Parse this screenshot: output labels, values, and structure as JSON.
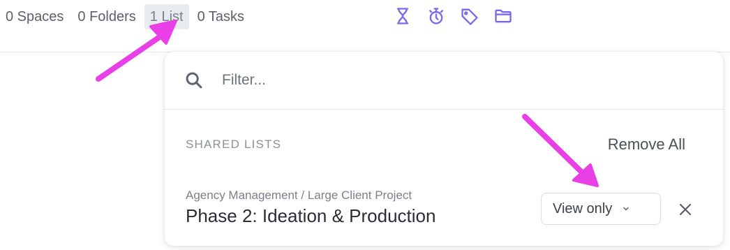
{
  "counts": [
    {
      "value": "0",
      "label": "Spaces"
    },
    {
      "value": "0",
      "label": "Folders"
    },
    {
      "value": "1",
      "label": "List"
    },
    {
      "value": "0",
      "label": "Tasks"
    }
  ],
  "count_texts": [
    "0 Spaces",
    "0 Folders",
    "1 List",
    "0 Tasks"
  ],
  "toolbar_icons": [
    "hourglass-icon",
    "stopwatch-icon",
    "tag-icon",
    "folder-icon"
  ],
  "accent_color": "#7b68ee",
  "annotation_color": "#e83fe6",
  "share_panel": {
    "filter_placeholder": "Filter...",
    "section_title": "SHARED LISTS",
    "remove_all_label": "Remove All",
    "items": [
      {
        "breadcrumb": "Agency Management / Large Client Project",
        "name": "Phase 2: Ideation & Production",
        "permission": "View only"
      }
    ]
  }
}
